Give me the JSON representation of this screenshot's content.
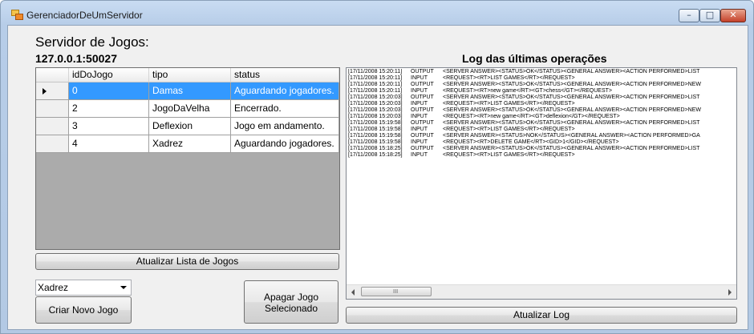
{
  "window": {
    "title": "GerenciadorDeUmServidor",
    "controls": {
      "minimize": "–",
      "maximize": "□",
      "close": "✕"
    }
  },
  "server": {
    "heading": "Servidor de Jogos:",
    "address": "127.0.0.1:50027"
  },
  "games_table": {
    "columns": [
      "idDoJogo",
      "tipo",
      "status"
    ],
    "rows": [
      {
        "id": "0",
        "tipo": "Damas",
        "status": "Aguardando jogadores.",
        "selected": true
      },
      {
        "id": "2",
        "tipo": "JogoDaVelha",
        "status": "Encerrado.",
        "selected": false
      },
      {
        "id": "3",
        "tipo": "Deflexion",
        "status": "Jogo em andamento.",
        "selected": false
      },
      {
        "id": "4",
        "tipo": "Xadrez",
        "status": "Aguardando jogadores.",
        "selected": false
      }
    ]
  },
  "buttons": {
    "refresh_games": "Atualizar Lista de Jogos",
    "create_game": "Criar Novo Jogo",
    "delete_game_line1": "Apagar Jogo",
    "delete_game_line2": "Selecionado",
    "refresh_log": "Atualizar Log"
  },
  "game_type_select": {
    "selected": "Xadrez"
  },
  "log": {
    "heading": "Log das últimas operações",
    "lines": [
      {
        "time": "[17/11/2008 15:20:11]",
        "dir": "OUTPUT",
        "msg": "<SERVER ANSWER><STATUS>OK</STATUS><GENERAL ANSWER><ACTION PERFORMED>LIST"
      },
      {
        "time": "[17/11/2008 15:20:11]",
        "dir": "INPUT",
        "msg": "<REQUEST><RT>LIST GAMES</RT></REQUEST>"
      },
      {
        "time": "[17/11/2008 15:20:11]",
        "dir": "OUTPUT",
        "msg": "<SERVER ANSWER><STATUS>OK</STATUS><GENERAL ANSWER><ACTION PERFORMED>NEW"
      },
      {
        "time": "[17/11/2008 15:20:11]",
        "dir": "INPUT",
        "msg": "<REQUEST><RT>new game</RT><GT>chess</GT></REQUEST>"
      },
      {
        "time": "[17/11/2008 15:20:03]",
        "dir": "OUTPUT",
        "msg": "<SERVER ANSWER><STATUS>OK</STATUS><GENERAL ANSWER><ACTION PERFORMED>LIST"
      },
      {
        "time": "[17/11/2008 15:20:03]",
        "dir": "INPUT",
        "msg": "<REQUEST><RT>LIST GAMES</RT></REQUEST>"
      },
      {
        "time": "[17/11/2008 15:20:03]",
        "dir": "OUTPUT",
        "msg": "<SERVER ANSWER><STATUS>OK</STATUS><GENERAL ANSWER><ACTION PERFORMED>NEW"
      },
      {
        "time": "[17/11/2008 15:20:03]",
        "dir": "INPUT",
        "msg": "<REQUEST><RT>new game</RT><GT>deflexion</GT></REQUEST>"
      },
      {
        "time": "[17/11/2008 15:19:58]",
        "dir": "OUTPUT",
        "msg": "<SERVER ANSWER><STATUS>OK</STATUS><GENERAL ANSWER><ACTION PERFORMED>LIST"
      },
      {
        "time": "[17/11/2008 15:19:58]",
        "dir": "INPUT",
        "msg": "<REQUEST><RT>LIST GAMES</RT></REQUEST>"
      },
      {
        "time": "[17/11/2008 15:19:58]",
        "dir": "OUTPUT",
        "msg": "<SERVER ANSWER><STATUS>NOK</STATUS><GENERAL ANSWER><ACTION PERFORMED>GA"
      },
      {
        "time": "[17/11/2008 15:19:58]",
        "dir": "INPUT",
        "msg": "<REQUEST><RT>DELETE GAME</RT><GID>1</GID></REQUEST>"
      },
      {
        "time": "[17/11/2008 15:18:25]",
        "dir": "OUTPUT",
        "msg": "<SERVER ANSWER><STATUS>OK</STATUS><GENERAL ANSWER><ACTION PERFORMED>LIST"
      },
      {
        "time": "[17/11/2008 15:18:25]",
        "dir": "INPUT",
        "msg": "<REQUEST><RT>LIST GAMES</RT></REQUEST>"
      }
    ],
    "scrollbar_grip": "III"
  },
  "colors": {
    "selection": "#3399ff",
    "grid_background": "#ababab",
    "title_bar": "#b7cde8"
  }
}
